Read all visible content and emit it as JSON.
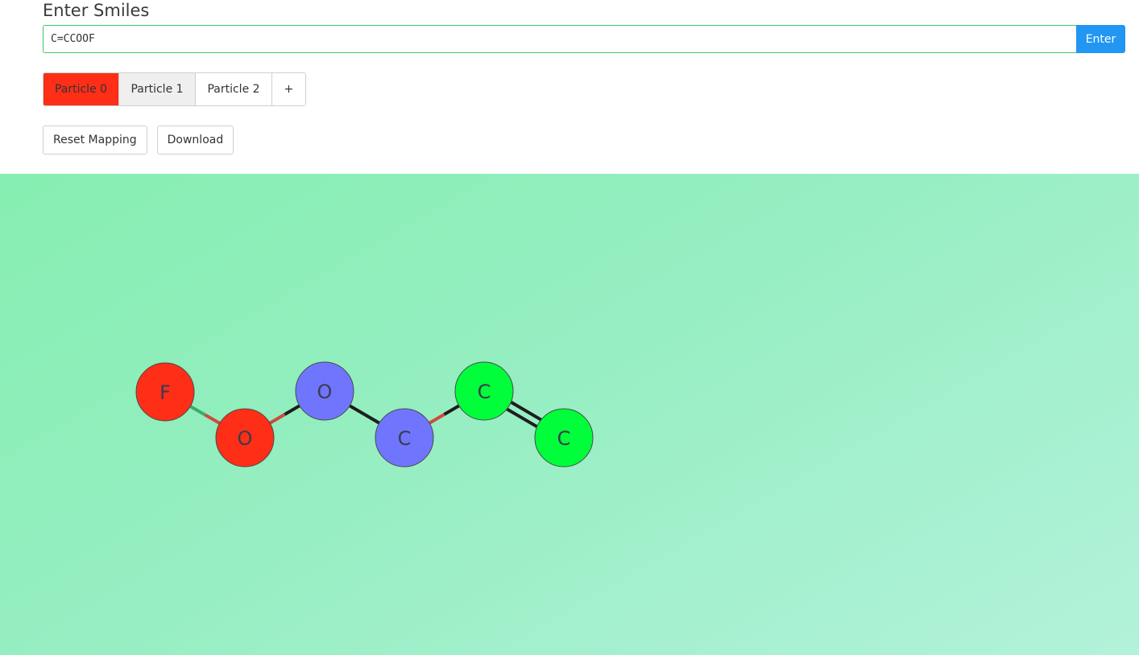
{
  "header": {
    "title": "Enter Smiles"
  },
  "smiles": {
    "value": "C=CCOOF",
    "enter_label": "Enter"
  },
  "particles": [
    {
      "label": "Particle 0",
      "color": "#ff2e17"
    },
    {
      "label": "Particle 1",
      "color": "#6f76fd"
    },
    {
      "label": "Particle 2",
      "color": "#00ff3a"
    }
  ],
  "add_particle_label": "+",
  "actions": {
    "reset_label": "Reset Mapping",
    "download_label": "Download"
  },
  "colors": {
    "selected_tab_bg": "#ff2e17",
    "hover_tab_bg": "#efefef",
    "input_border": "#3cc46a",
    "enter_bg": "#2196f3",
    "bond_single": "#1e1e1e",
    "bond_cross": "#cf4b3f",
    "bond_partial": "#3caa6e"
  },
  "molecule": {
    "atoms": [
      {
        "id": 0,
        "element": "F",
        "particle": 0
      },
      {
        "id": 1,
        "element": "O",
        "particle": 0
      },
      {
        "id": 2,
        "element": "O",
        "particle": 1
      },
      {
        "id": 3,
        "element": "C",
        "particle": 1
      },
      {
        "id": 4,
        "element": "C",
        "particle": 2
      },
      {
        "id": 5,
        "element": "C",
        "particle": 2
      }
    ],
    "bonds": [
      {
        "a": 0,
        "b": 1,
        "order": 1
      },
      {
        "a": 1,
        "b": 2,
        "order": 1
      },
      {
        "a": 2,
        "b": 3,
        "order": 1
      },
      {
        "a": 3,
        "b": 4,
        "order": 1
      },
      {
        "a": 4,
        "b": 5,
        "order": 2
      }
    ]
  }
}
